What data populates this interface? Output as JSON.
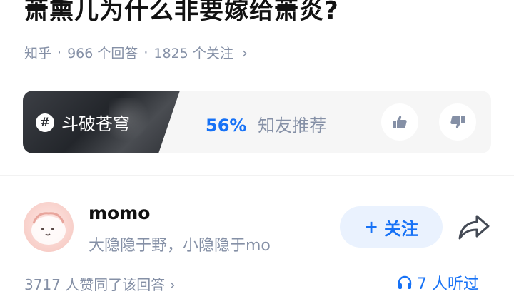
{
  "question": {
    "title": "萧熏儿为什么非要嫁给萧炎?",
    "source": "知乎",
    "separator": "·",
    "answers": "966 个回答",
    "followers": "1825 个关注",
    "chevron": "›"
  },
  "topic": {
    "icon": "hash-icon",
    "hash_symbol": "#",
    "name": "斗破苍穹",
    "percent": "56%",
    "recommend_label": "知友推荐"
  },
  "answer": {
    "author": {
      "name": "momo",
      "bio": "大隐隐于野，小隐隐于mo",
      "avatar": "avatar"
    },
    "follow_button": {
      "plus": "+",
      "label": "关注"
    },
    "agree_text": "3717 人赞同了该回答",
    "agree_chevron": "›",
    "listeners_text": "7 人听过"
  },
  "colors": {
    "accent": "#1772f6",
    "muted": "#8590a6",
    "follow_bg": "#eaf2fe"
  }
}
